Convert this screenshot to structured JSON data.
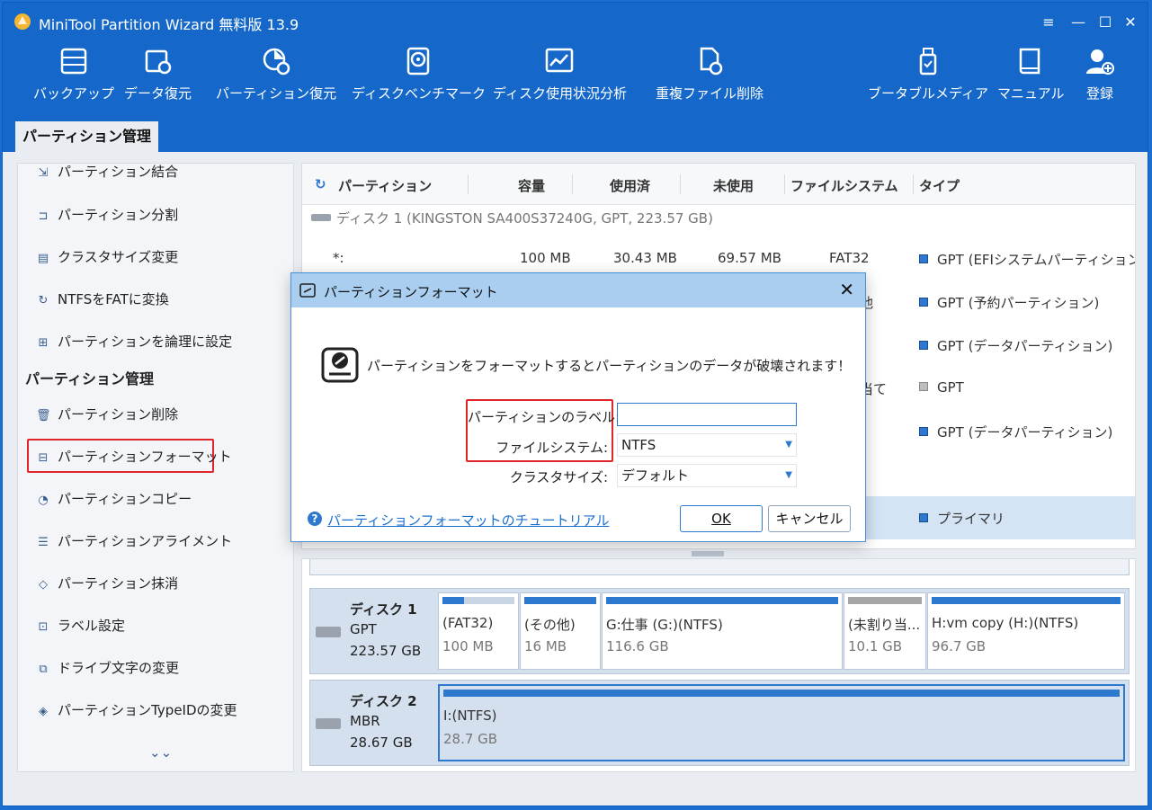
{
  "window": {
    "title": "MiniTool Partition Wizard 無料版 13.9"
  },
  "toolbar": [
    {
      "label": "バックアップ",
      "icon": "backup-icon"
    },
    {
      "label": "データ復元",
      "icon": "data-recovery-icon"
    },
    {
      "label": "パーティション復元",
      "icon": "partition-recovery-icon"
    },
    {
      "label": "ディスクベンチマーク",
      "icon": "disk-benchmark-icon"
    },
    {
      "label": "ディスク使用状況分析",
      "icon": "space-analyzer-icon"
    },
    {
      "label": "重複ファイル削除",
      "icon": "duplicate-file-icon"
    },
    {
      "label": "ブータブルメディア",
      "icon": "bootable-media-icon"
    },
    {
      "label": "マニュアル",
      "icon": "manual-icon"
    },
    {
      "label": "登録",
      "icon": "register-icon"
    }
  ],
  "tab": {
    "label": "パーティション管理"
  },
  "sidebar": {
    "items_top": [
      {
        "label": "パーティション結合",
        "icon": "merge-icon"
      },
      {
        "label": "パーティション分割",
        "icon": "split-icon"
      },
      {
        "label": "クラスタサイズ変更",
        "icon": "cluster-size-icon"
      },
      {
        "label": "NTFSをFATに変換",
        "icon": "convert-icon"
      },
      {
        "label": "パーティションを論理に設定",
        "icon": "set-logical-icon"
      }
    ],
    "heading": "パーティション管理",
    "items": [
      {
        "label": "パーティション削除",
        "icon": "trash-icon"
      },
      {
        "label": "パーティションフォーマット",
        "icon": "format-icon"
      },
      {
        "label": "パーティションコピー",
        "icon": "copy-icon"
      },
      {
        "label": "パーティションアライメント",
        "icon": "align-icon"
      },
      {
        "label": "パーティション抹消",
        "icon": "wipe-icon"
      },
      {
        "label": "ラベル設定",
        "icon": "label-icon"
      },
      {
        "label": "ドライブ文字の変更",
        "icon": "drive-letter-icon"
      },
      {
        "label": "パーティションTypeIDの変更",
        "icon": "typeid-icon"
      }
    ],
    "more": "⌄⌄"
  },
  "grid": {
    "headers": {
      "partition": "パーティション",
      "capacity": "容量",
      "used": "使用済",
      "unused": "未使用",
      "fs": "ファイルシステム",
      "type": "タイプ"
    },
    "disk1_line": "ディスク 1 (KINGSTON SA400S37240G, GPT, 223.57 GB)",
    "rows": [
      {
        "partition": "*:",
        "capacity": "100 MB",
        "used": "30.43 MB",
        "unused": "69.57 MB",
        "fs": "FAT32",
        "type": "GPT (EFIシステムパーティション)",
        "square": "blue"
      },
      {
        "partition": "",
        "capacity": "",
        "used": "",
        "unused": "",
        "fs": "他",
        "type": "GPT (予約パーティション)",
        "square": "blue"
      },
      {
        "partition": "",
        "capacity": "",
        "used": "",
        "unused": "",
        "fs": "",
        "type": "GPT (データパーティション)",
        "square": "blue"
      },
      {
        "partition": "",
        "capacity": "",
        "used": "",
        "unused": "",
        "fs": "当て",
        "type": "GPT",
        "square": "grey"
      },
      {
        "partition": "",
        "capacity": "",
        "used": "",
        "unused": "",
        "fs": "",
        "type": "GPT (データパーティション)",
        "square": "blue"
      },
      {
        "partition": "",
        "capacity": "",
        "used": "",
        "unused": "",
        "fs": "",
        "type": "プライマリ",
        "square": "blue"
      }
    ]
  },
  "disk_map": [
    {
      "name": "ディスク 1",
      "style": "GPT",
      "size": "223.57 GB",
      "partitions": [
        {
          "label": "(FAT32)",
          "size": "100 MB",
          "used_fraction": 0.3
        },
        {
          "label": "(その他)",
          "size": "16 MB",
          "used_fraction": 1.0
        },
        {
          "label": "G:仕事 (G:)(NTFS)",
          "size": "116.6 GB",
          "used_fraction": 1.0
        },
        {
          "label": "(未割り当...",
          "size": "10.1 GB",
          "used_fraction": 1.0,
          "unallocated": true
        },
        {
          "label": "H:vm copy (H:)(NTFS)",
          "size": "96.7 GB",
          "used_fraction": 1.0
        }
      ]
    },
    {
      "name": "ディスク 2",
      "style": "MBR",
      "size": "28.67 GB",
      "partitions": [
        {
          "label": "I:(NTFS)",
          "size": "28.7 GB",
          "used_fraction": 1.0
        }
      ]
    }
  ],
  "dialog": {
    "title": "パーティションフォーマット",
    "close": "✕",
    "warning": "パーティションをフォーマットするとパーティションのデータが破壊されます！",
    "label_label": "パーティションのラベル:",
    "label_value": "",
    "fs_label": "ファイルシステム:",
    "fs_value": "NTFS",
    "cluster_label": "クラスタサイズ:",
    "cluster_value": "デフォルト",
    "help_link": "パーティションフォーマットのチュートリアル",
    "ok": "OK",
    "cancel": "キャンセル"
  },
  "colors": {
    "accent": "#1568c9",
    "highlight": "#e0262a",
    "partition_bar": "#2e79d0"
  }
}
